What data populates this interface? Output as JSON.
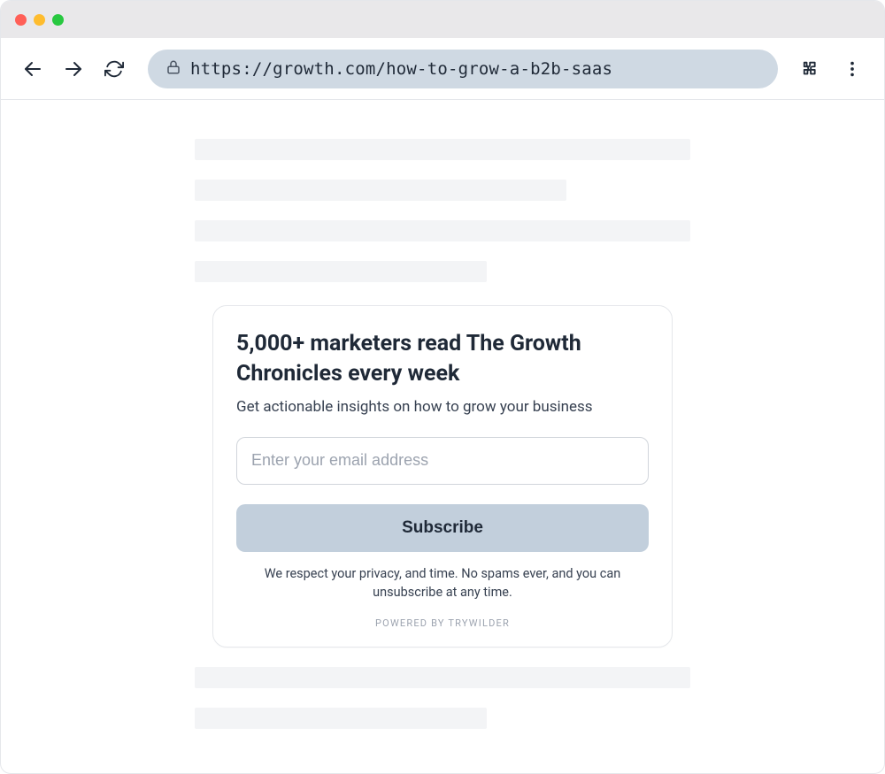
{
  "browser": {
    "url": "https://growth.com/how-to-grow-a-b2b-saas"
  },
  "card": {
    "title": "5,000+ marketers read The Growth Chronicles every week",
    "subtitle": "Get actionable insights on how to grow your business",
    "email_placeholder": "Enter your email address",
    "subscribe_label": "Subscribe",
    "privacy": "We respect your privacy, and time. No spams ever, and you can unsubscribe at any time.",
    "powered_by": "POWERED BY TRYWILDER"
  }
}
